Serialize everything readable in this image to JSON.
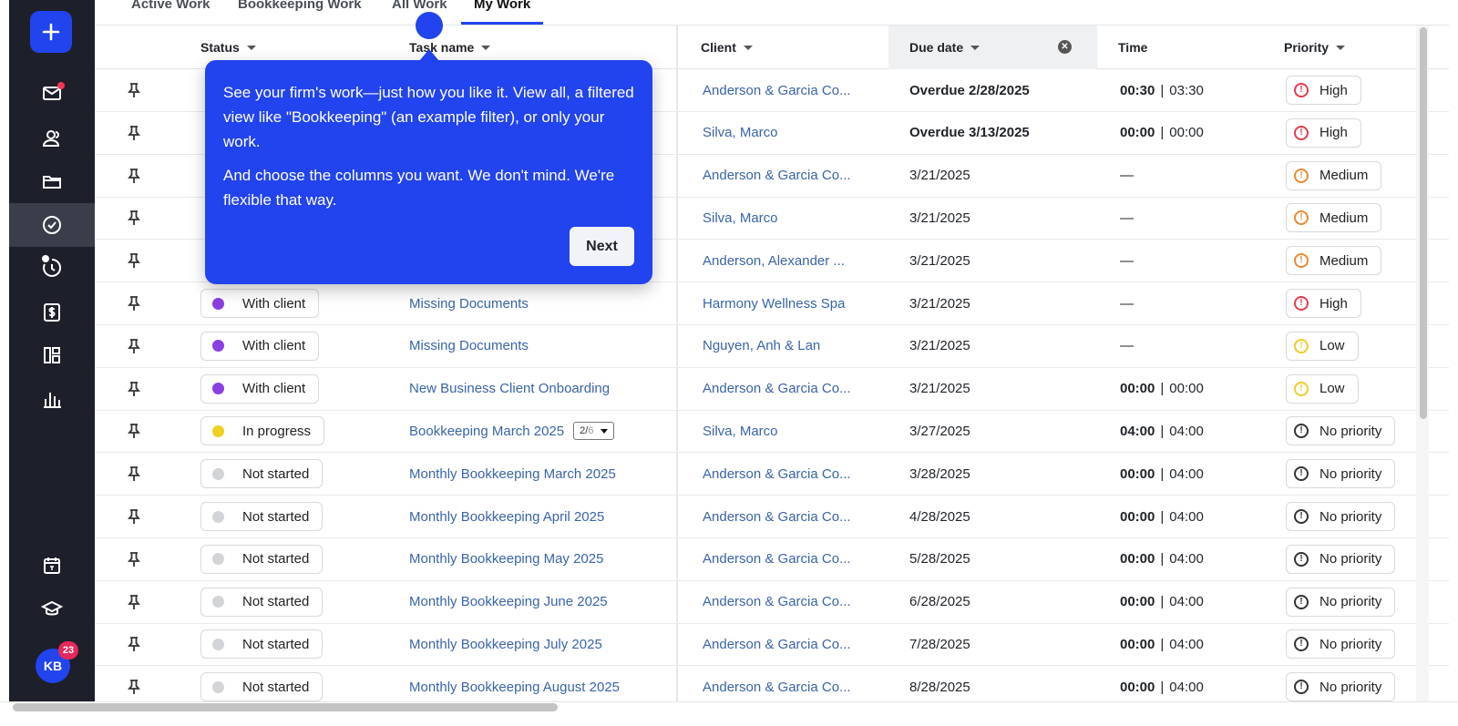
{
  "tabs": [
    {
      "label": "Active Work"
    },
    {
      "label": "Bookkeeping Work"
    },
    {
      "label": "All Work"
    },
    {
      "label": "My Work"
    }
  ],
  "columns": {
    "status": "Status",
    "task": "Task name",
    "client": "Client",
    "due": "Due date",
    "time": "Time",
    "priority": "Priority"
  },
  "tooltip": {
    "p1": "See your firm's work—just how you like it. View all, a filtered view like \"Bookkeeping\" (an example filter), or only your work.",
    "p2": "And choose the columns you want. We don't mind. We're flexible that way.",
    "next": "Next"
  },
  "user": {
    "initials": "KB",
    "badge": "23"
  },
  "colors": {
    "accent": "#2244ee",
    "with_client": "#8a3fe0",
    "in_progress": "#f0d020",
    "not_started": "#d3d4d8",
    "prio_high": "#e23d4f",
    "prio_medium": "#e88a34",
    "prio_low": "#efcc2a",
    "prio_none": "#333333"
  },
  "rows": [
    {
      "status": "",
      "task": "",
      "client": "Anderson & Garcia Co...",
      "due": "Overdue 2/28/2025",
      "overdue": true,
      "time_a": "00:30",
      "time_b": "03:30",
      "priority": "High"
    },
    {
      "status": "",
      "task": "",
      "client": "Silva, Marco",
      "due": "Overdue 3/13/2025",
      "overdue": true,
      "time_a": "00:00",
      "time_b": "00:00",
      "priority": "High"
    },
    {
      "status": "",
      "task": "",
      "client": "Anderson & Garcia Co...",
      "due": "3/21/2025",
      "overdue": false,
      "time_dash": "—",
      "priority": "Medium"
    },
    {
      "status": "",
      "task": "",
      "client": "Silva, Marco",
      "due": "3/21/2025",
      "overdue": false,
      "time_dash": "—",
      "priority": "Medium"
    },
    {
      "status": "",
      "task": "",
      "client": "Anderson, Alexander ...",
      "due": "3/21/2025",
      "overdue": false,
      "time_dash": "—",
      "priority": "Medium"
    },
    {
      "status": "With client",
      "task": "Missing Documents",
      "client": "Harmony Wellness Spa",
      "due": "3/21/2025",
      "overdue": false,
      "time_dash": "—",
      "priority": "High"
    },
    {
      "status": "With client",
      "task": "Missing Documents",
      "client": "Nguyen, Anh & Lan",
      "due": "3/21/2025",
      "overdue": false,
      "time_dash": "—",
      "priority": "Low"
    },
    {
      "status": "With client",
      "task": "New Business Client Onboarding",
      "client": "Anderson & Garcia Co...",
      "due": "3/21/2025",
      "overdue": false,
      "time_a": "00:00",
      "time_b": "00:00",
      "priority": "Low"
    },
    {
      "status": "In progress",
      "task": "Bookkeeping March 2025",
      "subtask_done": "2",
      "subtask_total": "6",
      "client": "Silva, Marco",
      "due": "3/27/2025",
      "overdue": false,
      "time_a": "04:00",
      "time_b": "04:00",
      "priority": "No priority"
    },
    {
      "status": "Not started",
      "task": "Monthly Bookkeeping March 2025",
      "client": "Anderson & Garcia Co...",
      "due": "3/28/2025",
      "overdue": false,
      "time_a": "00:00",
      "time_b": "04:00",
      "priority": "No priority"
    },
    {
      "status": "Not started",
      "task": "Monthly Bookkeeping April 2025",
      "client": "Anderson & Garcia Co...",
      "due": "4/28/2025",
      "overdue": false,
      "time_a": "00:00",
      "time_b": "04:00",
      "priority": "No priority"
    },
    {
      "status": "Not started",
      "task": "Monthly Bookkeeping May 2025",
      "client": "Anderson & Garcia Co...",
      "due": "5/28/2025",
      "overdue": false,
      "time_a": "00:00",
      "time_b": "04:00",
      "priority": "No priority"
    },
    {
      "status": "Not started",
      "task": "Monthly Bookkeeping June 2025",
      "client": "Anderson & Garcia Co...",
      "due": "6/28/2025",
      "overdue": false,
      "time_a": "00:00",
      "time_b": "04:00",
      "priority": "No priority"
    },
    {
      "status": "Not started",
      "task": "Monthly Bookkeeping July 2025",
      "client": "Anderson & Garcia Co...",
      "due": "7/28/2025",
      "overdue": false,
      "time_a": "00:00",
      "time_b": "04:00",
      "priority": "No priority"
    },
    {
      "status": "Not started",
      "task": "Monthly Bookkeeping August 2025",
      "client": "Anderson & Garcia Co...",
      "due": "8/28/2025",
      "overdue": false,
      "time_a": "00:00",
      "time_b": "04:00",
      "priority": "No priority"
    }
  ]
}
